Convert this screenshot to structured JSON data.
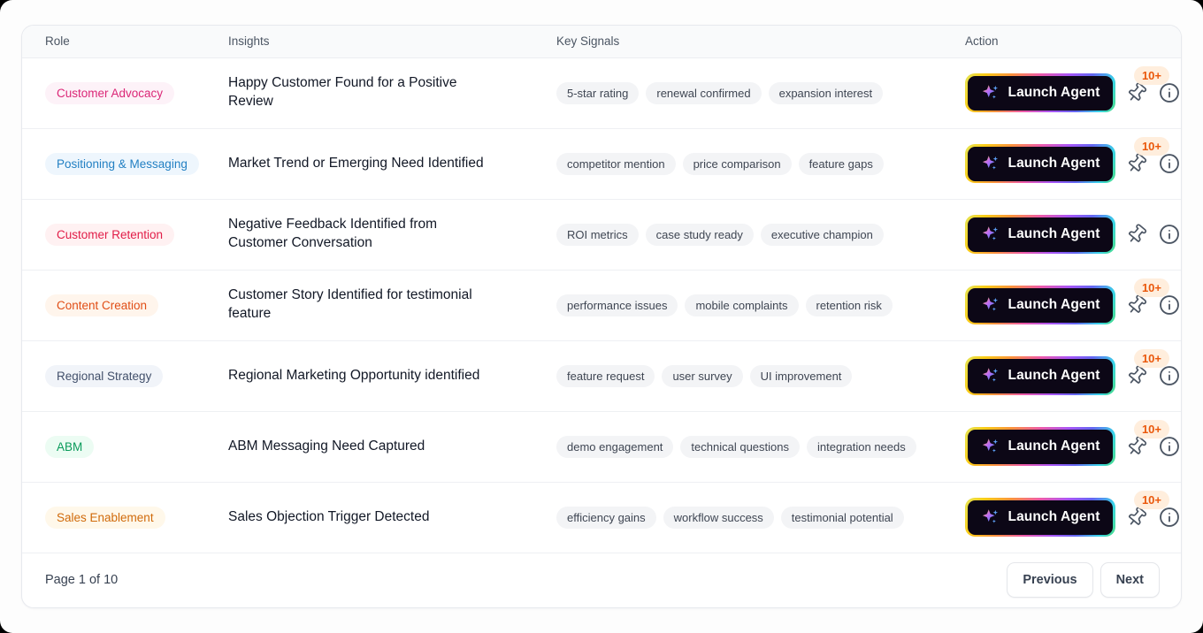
{
  "table": {
    "columns": [
      "Role",
      "Insights",
      "Key Signals",
      "Action"
    ],
    "launch_label": "Launch Agent",
    "badge_label": "10+",
    "rows": [
      {
        "role": "Customer Advocacy",
        "role_color": "#db2777",
        "role_bg": "#fdf2f8",
        "insight": "Happy Customer Found for a Positive Review",
        "signals": [
          "5-star rating",
          "renewal confirmed",
          "expansion interest"
        ],
        "badge": true
      },
      {
        "role": "Positioning & Messaging",
        "role_color": "#2380c3",
        "role_bg": "#eef6fd",
        "insight": "Market Trend or Emerging Need Identified",
        "signals": [
          "competitor mention",
          "price comparison",
          "feature gaps"
        ],
        "badge": true
      },
      {
        "role": "Customer Retention",
        "role_color": "#e11d48",
        "role_bg": "#fff1f2",
        "insight": "Negative Feedback Identified from Customer Conversation",
        "signals": [
          "ROI metrics",
          "case study ready",
          "executive champion"
        ],
        "badge": false
      },
      {
        "role": "Content Creation",
        "role_color": "#e04e16",
        "role_bg": "#fff5ec",
        "insight": "Customer Story Identified for testimonial feature",
        "signals": [
          "performance issues",
          "mobile complaints",
          "retention risk"
        ],
        "badge": true
      },
      {
        "role": "Regional Strategy",
        "role_color": "#42506b",
        "role_bg": "#f1f4f9",
        "insight": "Regional Marketing Opportunity identified",
        "signals": [
          "feature request",
          "user survey",
          "UI improvement"
        ],
        "badge": true
      },
      {
        "role": "ABM",
        "role_color": "#0b9b5b",
        "role_bg": "#ecfcf3",
        "insight": "ABM Messaging Need Captured",
        "signals": [
          "demo engagement",
          "technical questions",
          "integration needs"
        ],
        "badge": true
      },
      {
        "role": "Sales Enablement",
        "role_color": "#d06a0a",
        "role_bg": "#fff8ea",
        "insight": "Sales Objection Trigger Detected",
        "signals": [
          "efficiency gains",
          "workflow success",
          "testimonial potential"
        ],
        "badge": true
      }
    ]
  },
  "footer": {
    "page_status": "Page 1 of 10",
    "previous_label": "Previous",
    "next_label": "Next"
  },
  "theme": {
    "badge_text": "#ea580c",
    "badge_bg": "#ffeedd",
    "button_bg": "#0c0716",
    "header_bg": "#f9fafb"
  }
}
